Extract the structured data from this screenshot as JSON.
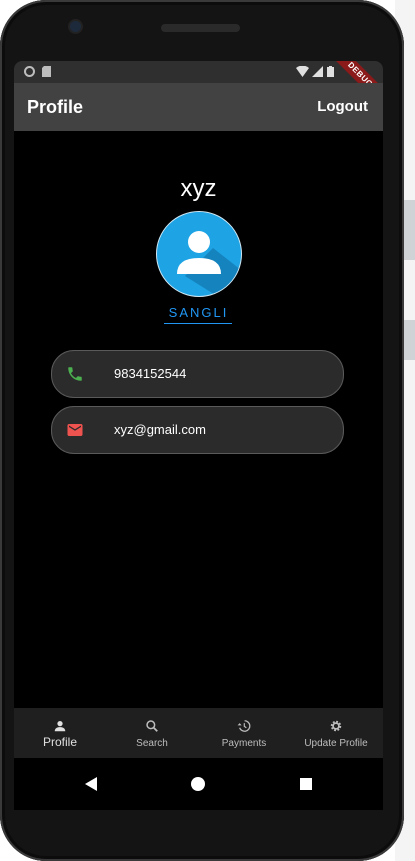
{
  "appbar": {
    "title": "Profile",
    "action": "Logout"
  },
  "banner": {
    "debug": "DEBUG"
  },
  "profile": {
    "name": "xyz",
    "city": "SANGLI",
    "phone": "9834152544",
    "email": "xyz@gmail.com"
  },
  "nav": {
    "items": [
      {
        "label": "Profile",
        "icon": "person-icon"
      },
      {
        "label": "Search",
        "icon": "search-icon"
      },
      {
        "label": "Payments",
        "icon": "history-icon"
      },
      {
        "label": "Update Profile",
        "icon": "gear-icon"
      }
    ],
    "active_index": 0
  },
  "colors": {
    "accent": "#2196f3",
    "avatar_bg": "#1ea3e4",
    "phone_icon": "#4caf50",
    "email_icon": "#ef5350",
    "appbar": "#424242",
    "background": "#000000"
  }
}
